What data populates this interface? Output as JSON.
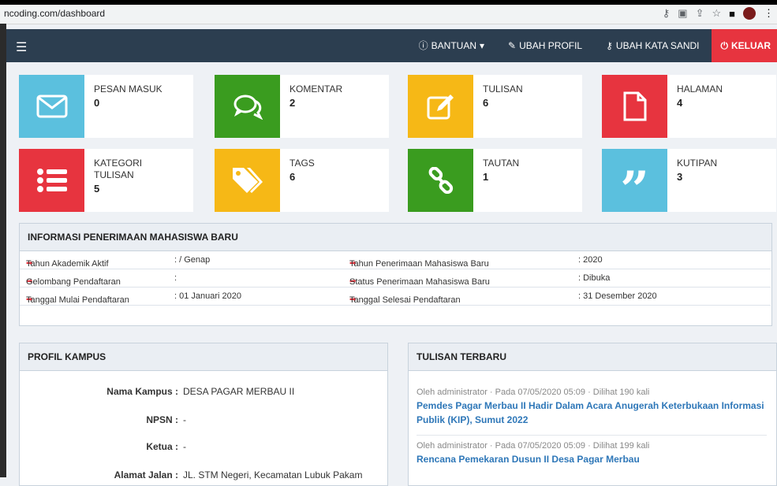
{
  "browser": {
    "url": "ncoding.com/dashboard"
  },
  "navbar": {
    "menu_icon": "hamburger-icon",
    "links": [
      {
        "label": "BANTUAN",
        "icon": "question-circle-icon",
        "caret": "▾"
      },
      {
        "label": "UBAH PROFIL",
        "icon": "edit-icon"
      },
      {
        "label": "UBAH KATA SANDI",
        "icon": "key-icon"
      },
      {
        "label": "KELUAR",
        "icon": "power-icon"
      }
    ]
  },
  "stats": [
    {
      "label": "PESAN MASUK",
      "value": "0",
      "icon": "envelope-icon",
      "color": "#5bc0de"
    },
    {
      "label": "KOMENTAR",
      "value": "2",
      "icon": "comments-icon",
      "color": "#3a9c1f"
    },
    {
      "label": "TULISAN",
      "value": "6",
      "icon": "pencil-square-icon",
      "color": "#f6b816"
    },
    {
      "label": "HALAMAN",
      "value": "4",
      "icon": "file-icon",
      "color": "#e7343f"
    },
    {
      "label": "KATEGORI",
      "label2": "TULISAN",
      "value": "5",
      "icon": "list-icon",
      "color": "#e7343f"
    },
    {
      "label": "TAGS",
      "value": "6",
      "icon": "tags-icon",
      "color": "#f6b816"
    },
    {
      "label": "TAUTAN",
      "value": "1",
      "icon": "link-icon",
      "color": "#3a9c1f"
    },
    {
      "label": "KUTIPAN",
      "value": "3",
      "icon": "quote-icon",
      "color": "#5bc0de"
    }
  ],
  "info": {
    "title": "INFORMASI PENERIMAAN MAHASISWA BARU",
    "rows": [
      {
        "k1": "Tahun Akademik Aktif",
        "v1": ":  / Genap",
        "k2": "Tahun Penerimaan Mahasiswa Baru",
        "v2": ":  2020"
      },
      {
        "k1": "Gelombang Pendaftaran",
        "v1": ":",
        "k2": "Status Penerimaan Mahasiswa Baru",
        "v2": ":  Dibuka"
      },
      {
        "k1": "Tanggal Mulai Pendaftaran",
        "v1": ":  01 Januari 2020",
        "k2": "Tanggal Selesai Pendaftaran",
        "v2": ":  31 Desember 2020"
      }
    ]
  },
  "profile": {
    "title": "PROFIL KAMPUS",
    "rows": [
      {
        "key": "Nama Kampus :",
        "value": "DESA PAGAR MERBAU II"
      },
      {
        "key": "NPSN :",
        "value": "-"
      },
      {
        "key": "Ketua :",
        "value": "-"
      },
      {
        "key": "Alamat Jalan :",
        "value": "JL. STM Negeri, Kecamatan Lubuk Pakam"
      }
    ]
  },
  "latest": {
    "title": "TULISAN TERBARU",
    "posts": [
      {
        "meta": "Oleh administrator · Pada 07/05/2020 05:09 · Dilihat 190 kali",
        "title": "Pemdes Pagar Merbau II Hadir Dalam Acara Anugerah Keterbukaan Informasi Publik (KIP), Sumut 2022"
      },
      {
        "meta": "Oleh administrator · Pada 07/05/2020 05:09 · Dilihat 199 kali",
        "title": "Rencana Pemekaran Dusun II Desa Pagar Merbau"
      }
    ]
  }
}
